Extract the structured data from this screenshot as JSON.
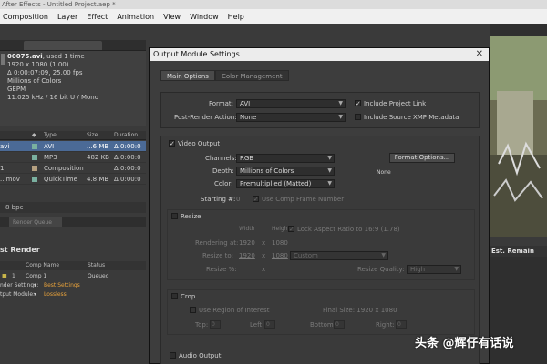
{
  "window": {
    "title": "After Effects - Untitled Project.aep *"
  },
  "menu": [
    "Composition",
    "Layer",
    "Effect",
    "Animation",
    "View",
    "Window",
    "Help"
  ],
  "project": {
    "file_name": "00075.avi",
    "used": ", used 1 time",
    "info": [
      "1920 x 1080 (1.00)",
      "Δ 0:00:07:09, 25.00 fps",
      "Millions of Colors",
      "GEPM",
      "11.025 kHz / 16 bit U / Mono"
    ],
    "columns": [
      "Type",
      "Size",
      "Duration"
    ],
    "rows": [
      {
        "name": "avi",
        "type": "AVI",
        "size": "...6 MB",
        "dur": "Δ 0:00:0",
        "color": "#7ab0a0",
        "selected": true
      },
      {
        "name": "",
        "type": "MP3",
        "size": "482 KB",
        "dur": "Δ 0:00:0",
        "color": "#7ab0a0",
        "selected": false
      },
      {
        "name": "1",
        "type": "Composition",
        "size": "",
        "dur": "Δ 0:00:0",
        "color": "#b5a080",
        "selected": false
      },
      {
        "name": "...mov",
        "type": "QuickTime",
        "size": "4.8 MB",
        "dur": "Δ 0:00:0",
        "color": "#7ab0a0",
        "selected": false
      }
    ],
    "bpc": "8 bpc"
  },
  "render_queue": {
    "tab_label": "Render Queue",
    "title": "st Render",
    "columns": [
      "Comp Name",
      "Status"
    ],
    "row": {
      "index": "1",
      "comp": "Comp 1",
      "status": "Queued"
    },
    "settings_label": "nder Settings:",
    "settings_value": "Best Settings",
    "module_label": "tput Module:",
    "module_value": "Lossless",
    "est_label": "Est. Remain"
  },
  "dialog": {
    "title": "Output Module Settings",
    "tabs": [
      "Main Options",
      "Color Management"
    ],
    "format_label": "Format:",
    "format_value": "AVI",
    "post_render_label": "Post-Render Action:",
    "post_render_value": "None",
    "include_project_link": "Include Project Link",
    "include_xmp": "Include Source XMP Metadata",
    "video_output": "Video Output",
    "channels_label": "Channels:",
    "channels_value": "RGB",
    "depth_label": "Depth:",
    "depth_value": "Millions of Colors",
    "color_label": "Color:",
    "color_value": "Premultiplied (Matted)",
    "format_options_btn": "Format Options...",
    "format_options_info": "None",
    "starting_label": "Starting #:",
    "starting_value": "0",
    "use_comp_frame": "Use Comp Frame Number",
    "resize": "Resize",
    "width_label": "Width",
    "height_label": "Height",
    "lock_aspect": "Lock Aspect Ratio to 16:9 (1.78)",
    "rendering_at": "Rendering at:",
    "rendering_w": "1920",
    "rendering_h": "1080",
    "resize_to": "Resize to:",
    "resize_w": "1920",
    "resize_h": "1080",
    "resize_preset": "Custom",
    "resize_pct": "Resize %:",
    "resize_quality_label": "Resize Quality:",
    "resize_quality_value": "High",
    "times": "x",
    "crop": "Crop",
    "use_roi": "Use Region of Interest",
    "final_size": "Final Size: 1920 x 1080",
    "top": "Top:",
    "left": "Left:",
    "bottom": "Bottom:",
    "right": "Right:",
    "zero": "0",
    "audio_output": "Audio Output",
    "checkmark": "✓"
  },
  "watermark": "头条 @辉仔有话说"
}
